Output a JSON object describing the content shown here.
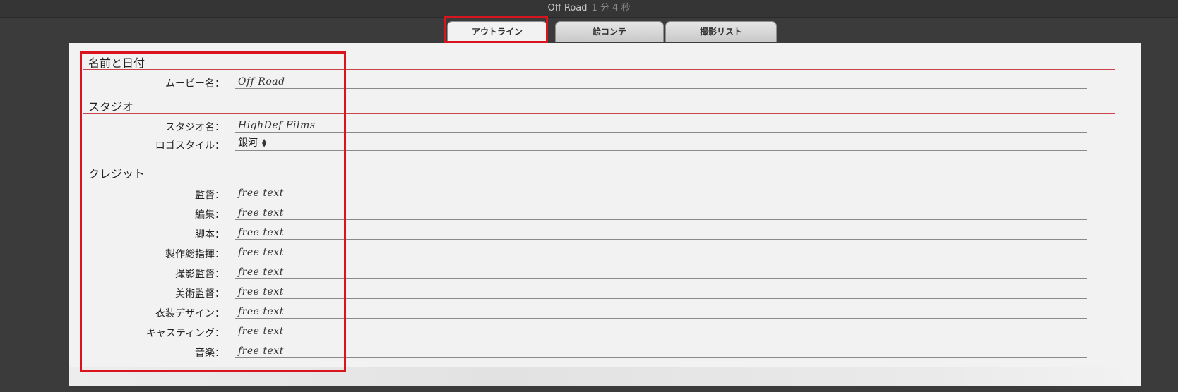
{
  "window": {
    "title": "Off Road",
    "duration": "1 分 4 秒"
  },
  "tabs": [
    {
      "label": "アウトライン",
      "active": true
    },
    {
      "label": "絵コンテ",
      "active": false
    },
    {
      "label": "撮影リスト",
      "active": false
    }
  ],
  "sections": {
    "name_date": {
      "title": "名前と日付",
      "movie_name_label": "ムービー名：",
      "movie_name_value": "Off Road"
    },
    "studio": {
      "title": "スタジオ",
      "studio_name_label": "スタジオ名：",
      "studio_name_value": "HighDef Films",
      "logo_style_label": "ロゴスタイル：",
      "logo_style_value": "銀河"
    },
    "credits": {
      "title": "クレジット",
      "rows": [
        {
          "label": "監督：",
          "value": "free text"
        },
        {
          "label": "編集：",
          "value": "free text"
        },
        {
          "label": "脚本：",
          "value": "free text"
        },
        {
          "label": "製作総指揮：",
          "value": "free text"
        },
        {
          "label": "撮影監督：",
          "value": "free text"
        },
        {
          "label": "美術監督：",
          "value": "free text"
        },
        {
          "label": "衣装デザイン：",
          "value": "free text"
        },
        {
          "label": "キャスティング：",
          "value": "free text"
        },
        {
          "label": "音楽：",
          "value": "free text"
        }
      ]
    }
  },
  "colors": {
    "highlight": "#d9141c",
    "section_rule": "#c8464b",
    "background": "#3b3b3b",
    "panel": "#f2f2f2"
  }
}
